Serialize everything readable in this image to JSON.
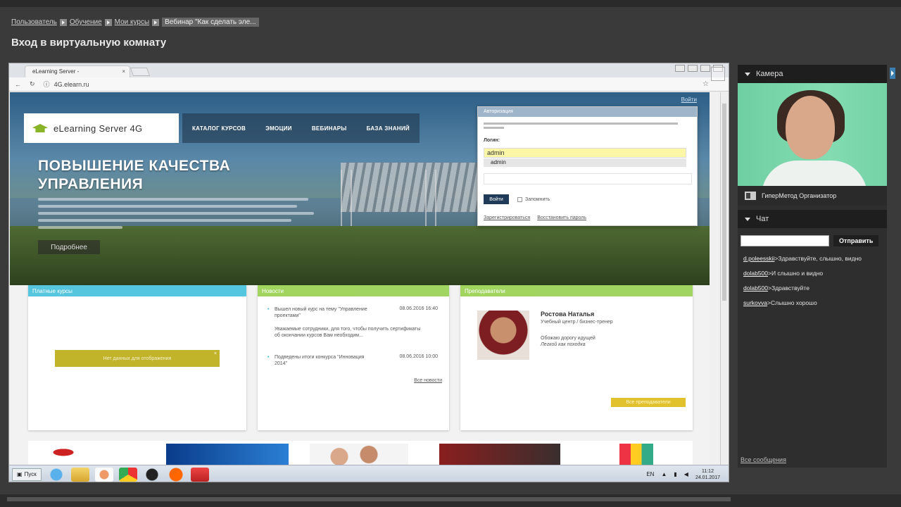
{
  "breadcrumb": {
    "items": [
      "Пользователь",
      "Обучение",
      "Мои курсы"
    ],
    "current": "Вебинар \"Как сделать эле..."
  },
  "page_title": "Вход в виртуальную комнату",
  "shared_screen": {
    "browser": {
      "tab_title": "eLearning Server -",
      "tab_close": "×",
      "url": "4G.elearn.ru"
    },
    "site": {
      "logo_text": "eLearning Server 4G",
      "nav": [
        "КАТАЛОГ КУРСОВ",
        "ЭМОЦИИ",
        "ВЕБИНАРЫ",
        "БАЗА ЗНАНИЙ"
      ],
      "top_link": "Войти",
      "hero_title_line1": "ПОВЫШЕНИЕ КАЧЕСТВА",
      "hero_title_line2": "УПРАВЛЕНИЯ",
      "more_button": "Подробнее",
      "login": {
        "header": "Авторизация",
        "label_login": "Логин:",
        "input_value": "admin",
        "autocomplete": "admin",
        "login_button": "Войти",
        "remember": "Запомнить",
        "register_link": "Зарегистрироваться",
        "restore_link": "Восстановить пароль"
      },
      "card_courses": {
        "title": "Платные курсы",
        "no_data": "Нет данных для отображения",
        "close": "×"
      },
      "card_news": {
        "title": "Новости",
        "items": [
          {
            "text": "Вышел новый курс на тему \"Управление проектами\"",
            "date": "08.06.2016 16:40",
            "sub": "Уважаемые сотрудники, для того, чтобы получить сертификаты об окончании курсов Вам необходим..."
          },
          {
            "text": "Подведены итоги конкурса \"Инновация 2014\"",
            "date": "08.06.2016 10:00"
          }
        ],
        "all_news": "Все новости"
      },
      "card_tutors": {
        "title": "Преподаватели",
        "name": "Ростова Наталья",
        "role": "Учебный центр / бизнес-тренер",
        "line1": "Обожаю дорогу идущей",
        "line2": "Легкой как походка",
        "all_tutors": "Все преподаватели"
      }
    },
    "taskbar": {
      "start": "Пуск",
      "lang": "EN",
      "time": "11:12",
      "date": "24.01.2017"
    }
  },
  "camera_panel": {
    "title": "Камера",
    "presenter": "ГиперМетод Организатор"
  },
  "chat_panel": {
    "title": "Чат",
    "send_button": "Отправить",
    "messages": [
      {
        "user": "d.poleesskii",
        "text": "Здравствуйте, слышно, видно"
      },
      {
        "user": "dolab500",
        "text": "И слышно и видно"
      },
      {
        "user": "dolab500",
        "text": "Здравствуйте"
      },
      {
        "user": "surkovva",
        "text": "Слышно хорошо"
      }
    ],
    "all_messages": "Все сообщения"
  },
  "colors": {
    "accent_blue": "#2bb8d7",
    "accent_green": "#8acb39",
    "accent_yellow": "#e1c12c",
    "panel_bg": "#2e2e2e"
  }
}
